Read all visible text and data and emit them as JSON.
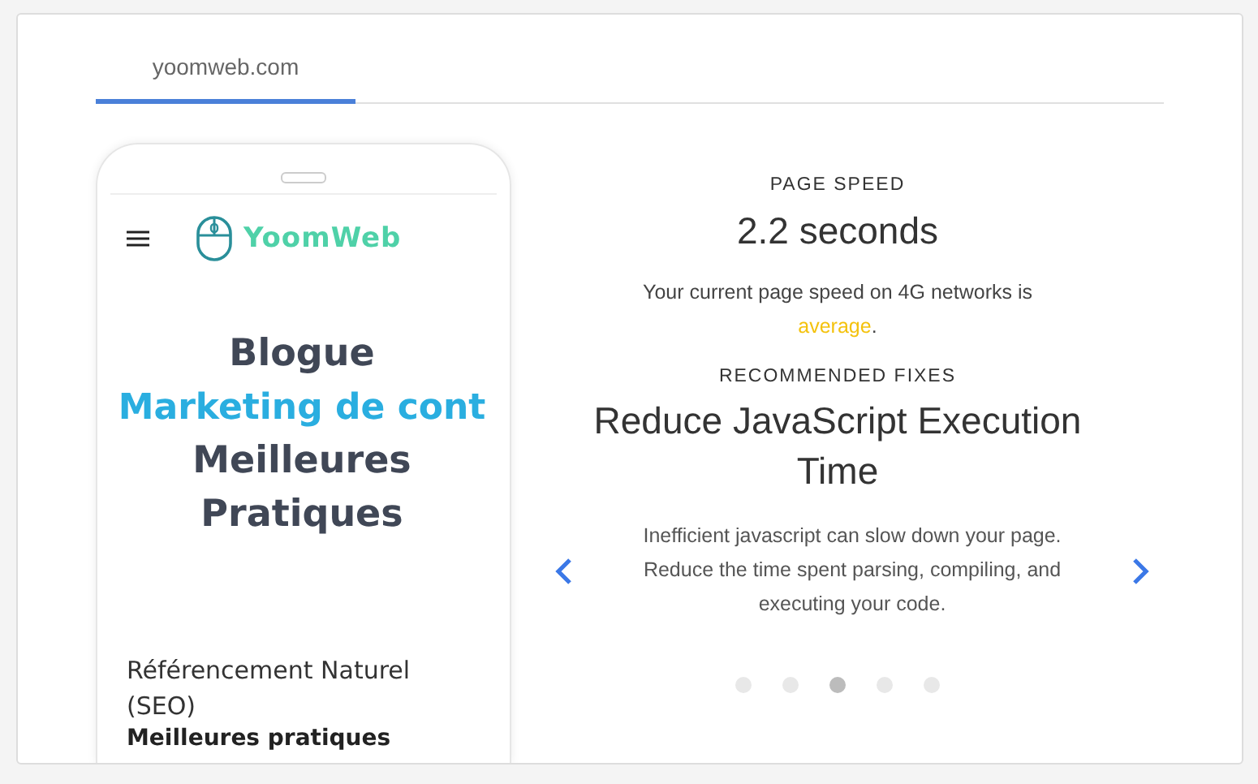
{
  "tabs": [
    {
      "label": "yoomweb.com",
      "selected": true
    }
  ],
  "phone": {
    "logo": "YoomWeb",
    "heading_lines": [
      {
        "text": "Blogue",
        "kind": "plain"
      },
      {
        "text": "Marketing de cont",
        "kind": "accent"
      },
      {
        "text": "Meilleures",
        "kind": "plain"
      },
      {
        "text": "Pratiques",
        "kind": "plain"
      }
    ],
    "body": "Référencement Naturel (SEO)",
    "body_bold": "Meilleures pratiques"
  },
  "page_speed": {
    "label": "PAGE SPEED",
    "value": "2.2 seconds",
    "note_before": "Your current page speed on 4G networks is ",
    "rating": "average",
    "note_after": "."
  },
  "fixes": {
    "label": "RECOMMENDED FIXES",
    "title": "Reduce JavaScript Execution Time",
    "description": "Inefficient javascript can slow down your page. Reduce the time spent parsing, compiling, and executing your code.",
    "dots": [
      {
        "selected": false
      },
      {
        "selected": false
      },
      {
        "selected": true
      },
      {
        "selected": false
      },
      {
        "selected": false
      }
    ]
  }
}
